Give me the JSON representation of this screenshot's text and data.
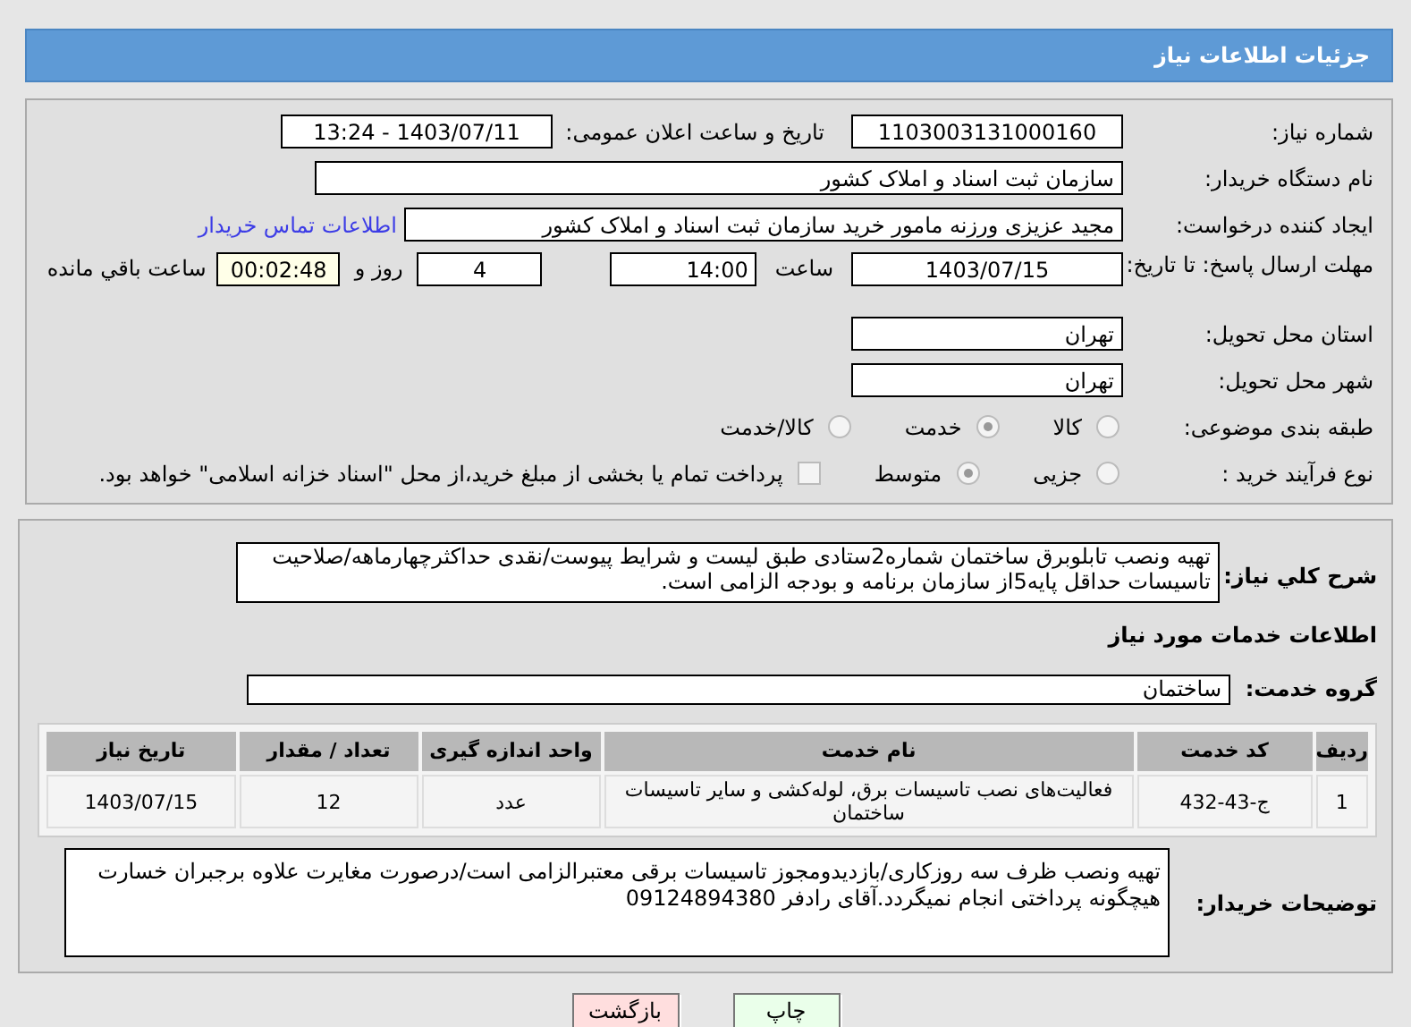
{
  "header": {
    "title": "جزئیات اطلاعات نیاز"
  },
  "need_number": {
    "label": "شماره نیاز:",
    "value": "1103003131000160"
  },
  "announce": {
    "label": "تاریخ و ساعت اعلان عمومی:",
    "value": "1403/07/11 - 13:24"
  },
  "buyer_org": {
    "label": "نام دستگاه خریدار:",
    "value": "سازمان ثبت اسناد و املاک کشور"
  },
  "creator": {
    "label": "ایجاد کننده درخواست:",
    "value": "مجید عزیزی ورزنه مامور خرید سازمان ثبت اسناد و املاک کشور",
    "link": "اطلاعات تماس خریدار"
  },
  "deadline": {
    "label": "مهلت ارسال پاسخ: تا تاریخ:",
    "date": "1403/07/15",
    "time_label": "ساعت",
    "time": "14:00",
    "days": "4",
    "days_label": "روز و",
    "remaining": "00:02:48",
    "remaining_label": "ساعت باقي مانده"
  },
  "province": {
    "label": "استان محل تحویل:",
    "value": "تهران"
  },
  "city": {
    "label": "شهر محل تحویل:",
    "value": "تهران"
  },
  "category": {
    "label": "طبقه بندی موضوعی:",
    "options": [
      {
        "label": "کالا",
        "selected": false
      },
      {
        "label": "خدمت",
        "selected": true
      },
      {
        "label": "کالا/خدمت",
        "selected": false
      }
    ]
  },
  "purchase_type": {
    "label": "نوع فرآیند خرید :",
    "options": [
      {
        "label": "جزیی",
        "selected": false
      },
      {
        "label": "متوسط",
        "selected": true
      }
    ],
    "payment": {
      "checked": false,
      "label": "پرداخت تمام یا بخشی از مبلغ خرید،از محل \"اسناد خزانه اسلامی\" خواهد بود."
    }
  },
  "description": {
    "label": "شرح کلي نیاز:",
    "value": "تهیه ونصب تابلوبرق ساختمان شماره2ستادی طبق لیست و شرایط پیوست/نقدی حداکثرچهارماهه/صلاحیت تاسیسات حداقل پایه5از سازمان برنامه و بودجه الزامی است."
  },
  "services_heading": "اطلاعات خدمات مورد نیاز",
  "service_group": {
    "label": "گروه خدمت:",
    "value": "ساختمان"
  },
  "table": {
    "columns": [
      "ردیف",
      "کد خدمت",
      "نام خدمت",
      "واحد اندازه گیری",
      "تعداد / مقدار",
      "تاریخ نیاز"
    ],
    "rows": [
      [
        "1",
        "ج-43-432",
        "فعالیت‌های نصب تاسیسات برق، لوله‌کشی و سایر تاسیسات ساختمان",
        "عدد",
        "12",
        "1403/07/15"
      ]
    ]
  },
  "buyer_notes": {
    "label": "توضیحات خریدار:",
    "value": "تهیه ونصب ظرف سه روزکاری/بازدیدومجوز تاسیسات برقی معتبرالزامی است/درصورت مغایرت علاوه برجبران خسارت هیچگونه پرداختی انجام نمیگردد.آقای رادفر 09124894380"
  },
  "buttons": [
    {
      "label": "چاپ",
      "kind": "print"
    },
    {
      "label": "بازگشت",
      "kind": "back"
    }
  ]
}
